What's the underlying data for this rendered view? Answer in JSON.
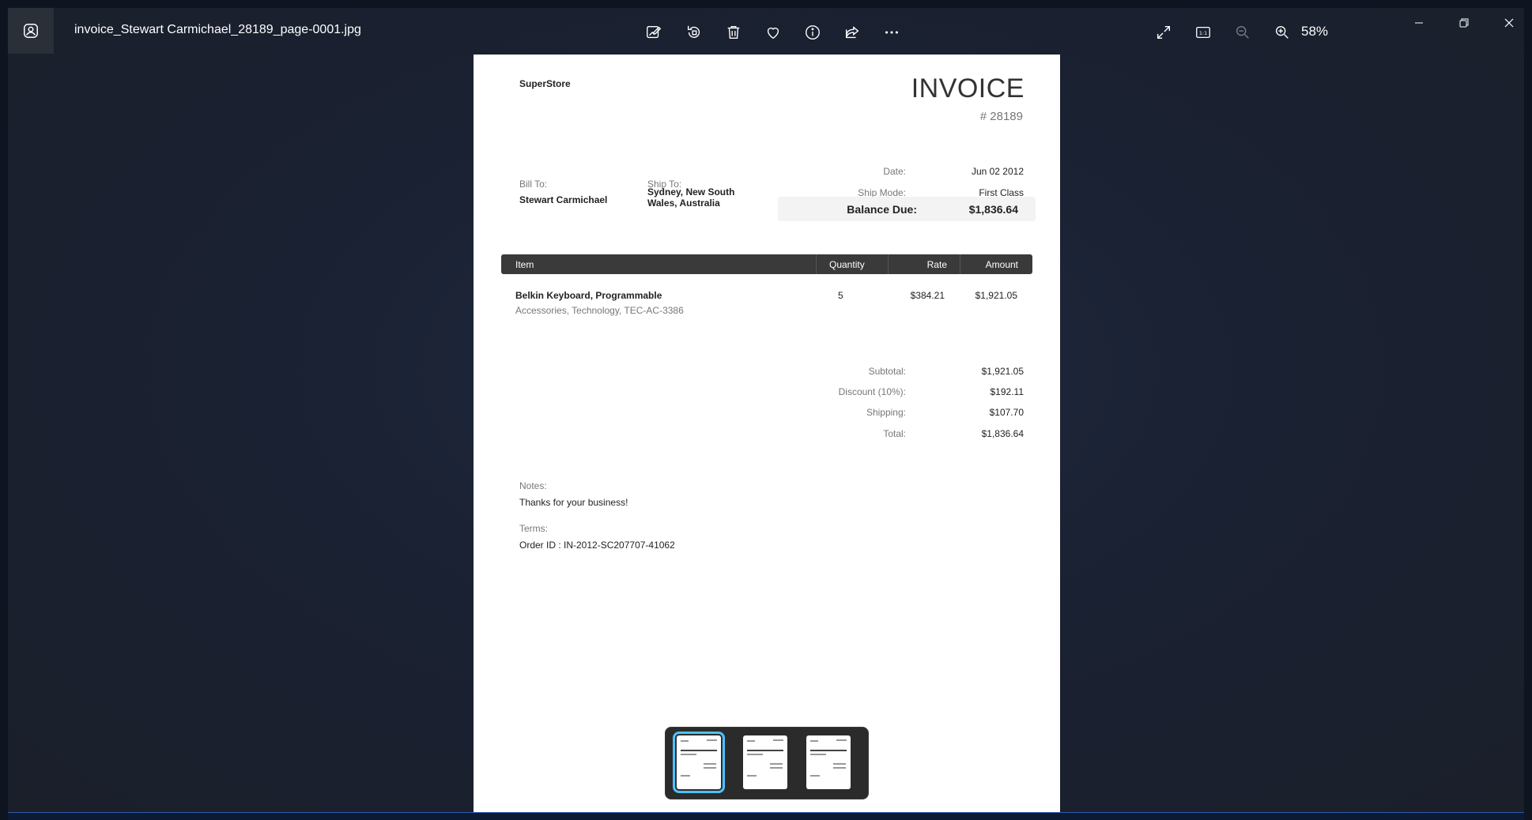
{
  "titlebar": {
    "filename": "invoice_Stewart Carmichael_28189_page-0001.jpg",
    "zoom": "58%",
    "tools": [
      "edit-image-icon",
      "rotate-icon",
      "delete-icon",
      "favorite-icon",
      "info-icon",
      "share-icon",
      "more-icon"
    ],
    "view_tools": [
      "fullscreen-icon",
      "actual-size-icon",
      "zoom-out-icon",
      "zoom-in-icon"
    ]
  },
  "invoice": {
    "company": "SuperStore",
    "title": "INVOICE",
    "number": "# 28189",
    "bill_to_label": "Bill To:",
    "bill_to": "Stewart Carmichael",
    "ship_to_label": "Ship To:",
    "ship_to": "Sydney, New South Wales, Australia",
    "date_label": "Date:",
    "date": "Jun 02 2012",
    "ship_mode_label": "Ship Mode:",
    "ship_mode": "First Class",
    "balance_label": "Balance Due:",
    "balance": "$1,836.64",
    "columns": [
      "Item",
      "Quantity",
      "Rate",
      "Amount"
    ],
    "items": [
      {
        "name": "Belkin Keyboard, Programmable",
        "desc": "Accessories, Technology, TEC-AC-3386",
        "quantity": "5",
        "rate": "$384.21",
        "amount": "$1,921.05"
      }
    ],
    "subtotal_label": "Subtotal:",
    "subtotal": "$1,921.05",
    "discount_label": "Discount (10%):",
    "discount": "$192.11",
    "shipping_label": "Shipping:",
    "shipping": "$107.70",
    "total_label": "Total:",
    "total": "$1,836.64",
    "notes_label": "Notes:",
    "notes": "Thanks for your business!",
    "terms_label": "Terms:",
    "terms": "Order ID : IN-2012-SC207707-41062"
  },
  "filmstrip": {
    "count": 3,
    "selected_index": 0
  },
  "colors": {
    "accent": "#4cc2ff",
    "table_header": "#3a3a3a",
    "background": "#1a2132"
  }
}
